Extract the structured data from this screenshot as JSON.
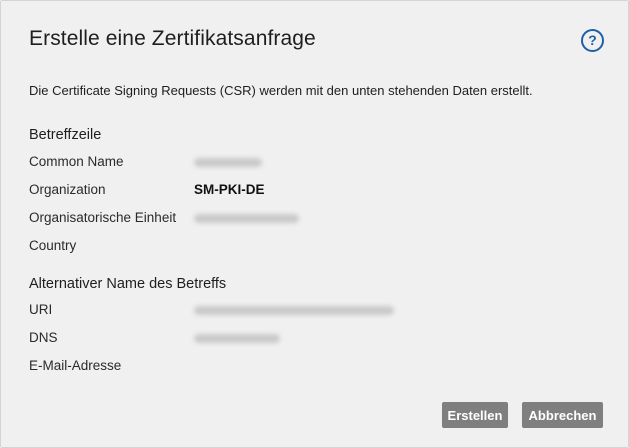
{
  "dialog": {
    "title": "Erstelle eine Zertifikatsanfrage",
    "help_icon": "question-circle-icon",
    "help_symbol": "?",
    "intro": "Die Certificate Signing Requests (CSR) werden mit den unten stehenden Daten erstellt."
  },
  "subject": {
    "heading": "Betreffzeile",
    "rows": [
      {
        "label": "Common Name",
        "value": ""
      },
      {
        "label": "Organization",
        "value": "SM-PKI-DE"
      },
      {
        "label": "Organisatorische Einheit",
        "value": ""
      },
      {
        "label": "Country",
        "value": ""
      }
    ]
  },
  "alt_name": {
    "heading": "Alternativer Name des Betreffs",
    "rows": [
      {
        "label": "URI",
        "value": ""
      },
      {
        "label": "DNS",
        "value": ""
      },
      {
        "label": "E-Mail-Adresse",
        "value": ""
      }
    ]
  },
  "buttons": {
    "create": "Erstellen",
    "cancel": "Abbrechen"
  },
  "colors": {
    "dialog_bg": "#f0f0f0",
    "help_icon": "#1f5fa8",
    "button_bg": "#7f7f7f",
    "button_text": "#ffffff"
  }
}
